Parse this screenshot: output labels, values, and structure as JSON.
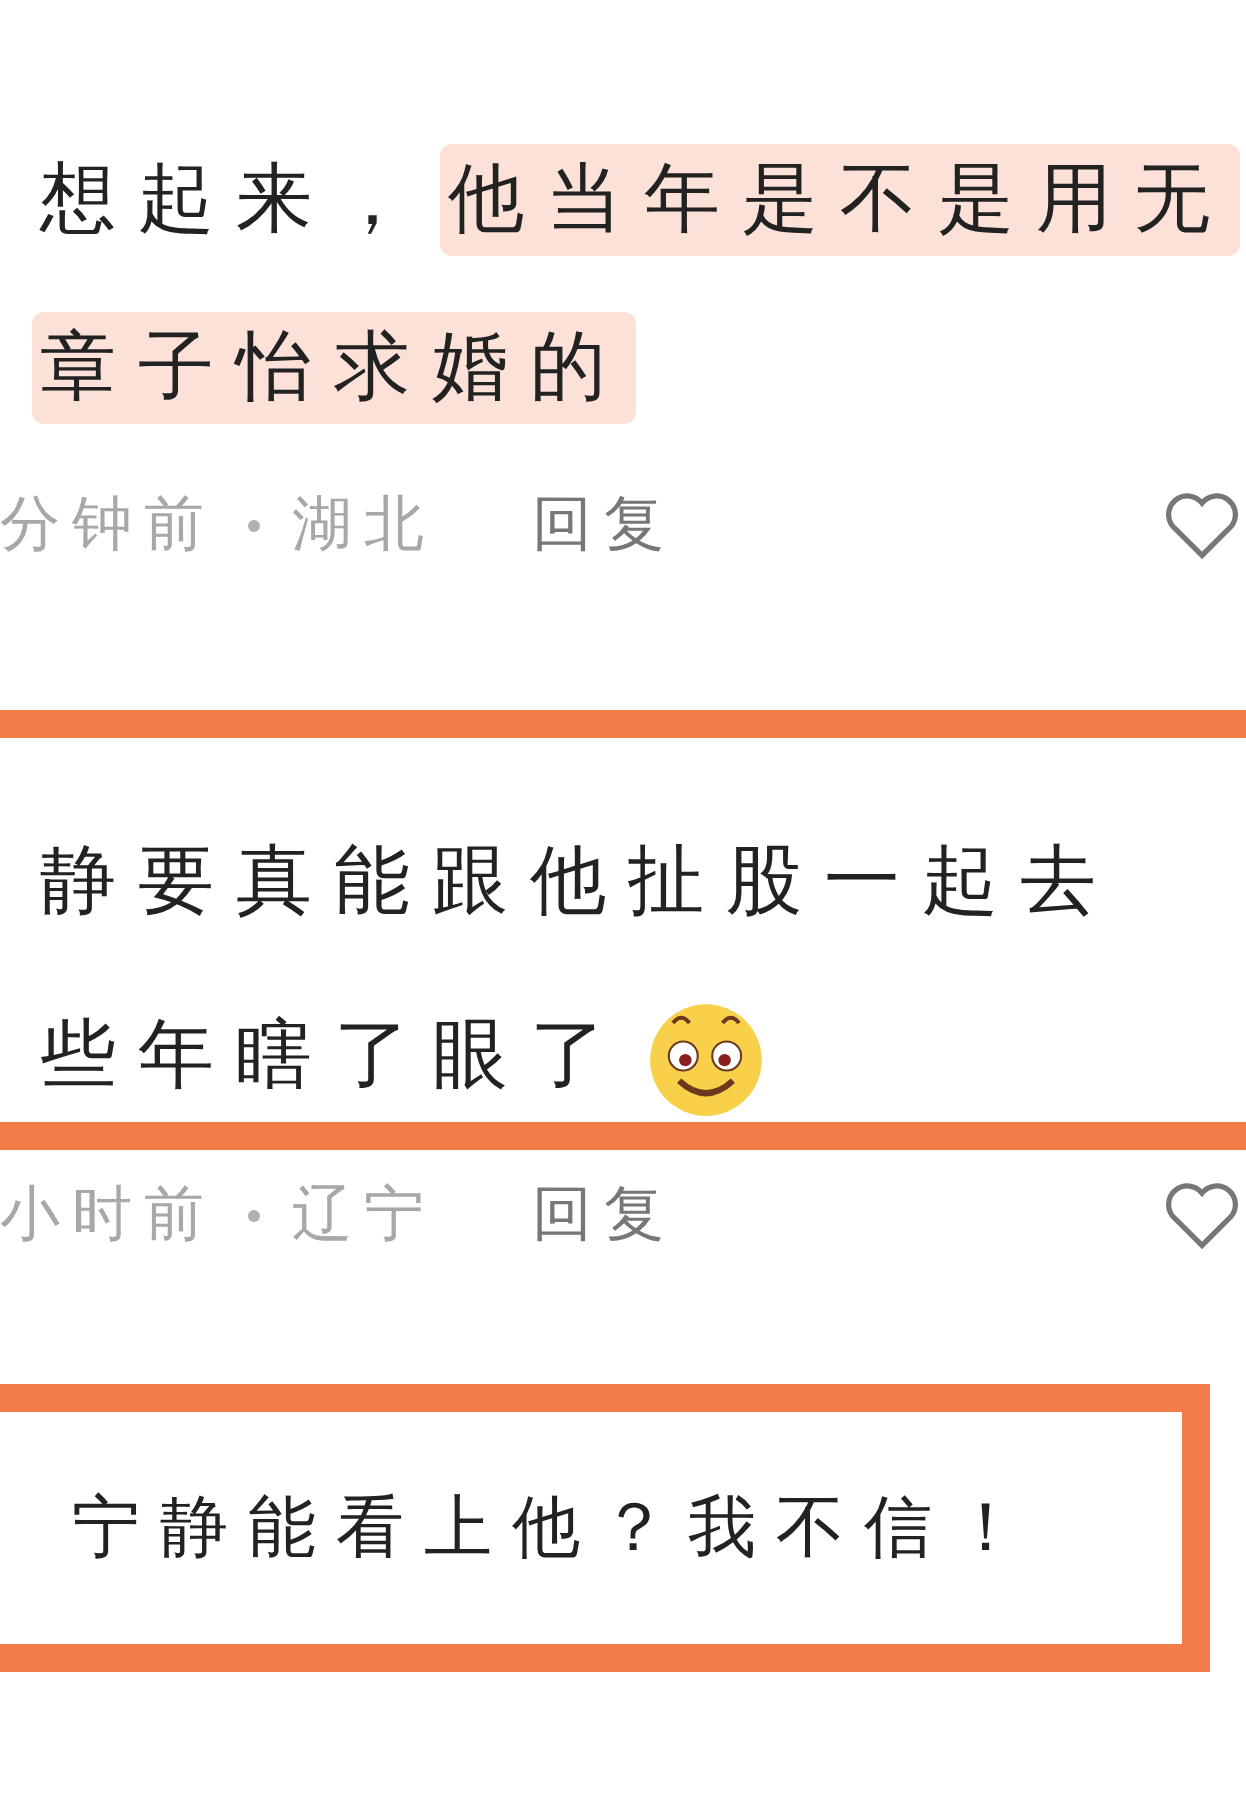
{
  "comments": [
    {
      "kind": "plain",
      "lines": [
        [
          {
            "text": "想起来，",
            "highlighted": false
          },
          {
            "text": "他当年是不是用无",
            "highlighted": true
          }
        ],
        [
          {
            "text": "章子怡求婚的",
            "highlighted": true
          }
        ]
      ],
      "emoji": false,
      "meta": {
        "time": "分钟前",
        "location": "湖北",
        "reply": "回复",
        "liked": false
      }
    },
    {
      "kind": "bars",
      "lines": [
        [
          {
            "text": "静要真能跟他扯股一起去",
            "highlighted": false
          }
        ],
        [
          {
            "text": "些年瞎了眼了",
            "highlighted": false
          }
        ]
      ],
      "emoji": true,
      "meta": {
        "time": "小时前",
        "location": "辽宁",
        "reply": "回复",
        "liked": false
      }
    },
    {
      "kind": "box",
      "lines": [
        [
          {
            "text": "宁静能看上他？我不信！",
            "highlighted": false
          }
        ]
      ],
      "emoji": false
    }
  ]
}
